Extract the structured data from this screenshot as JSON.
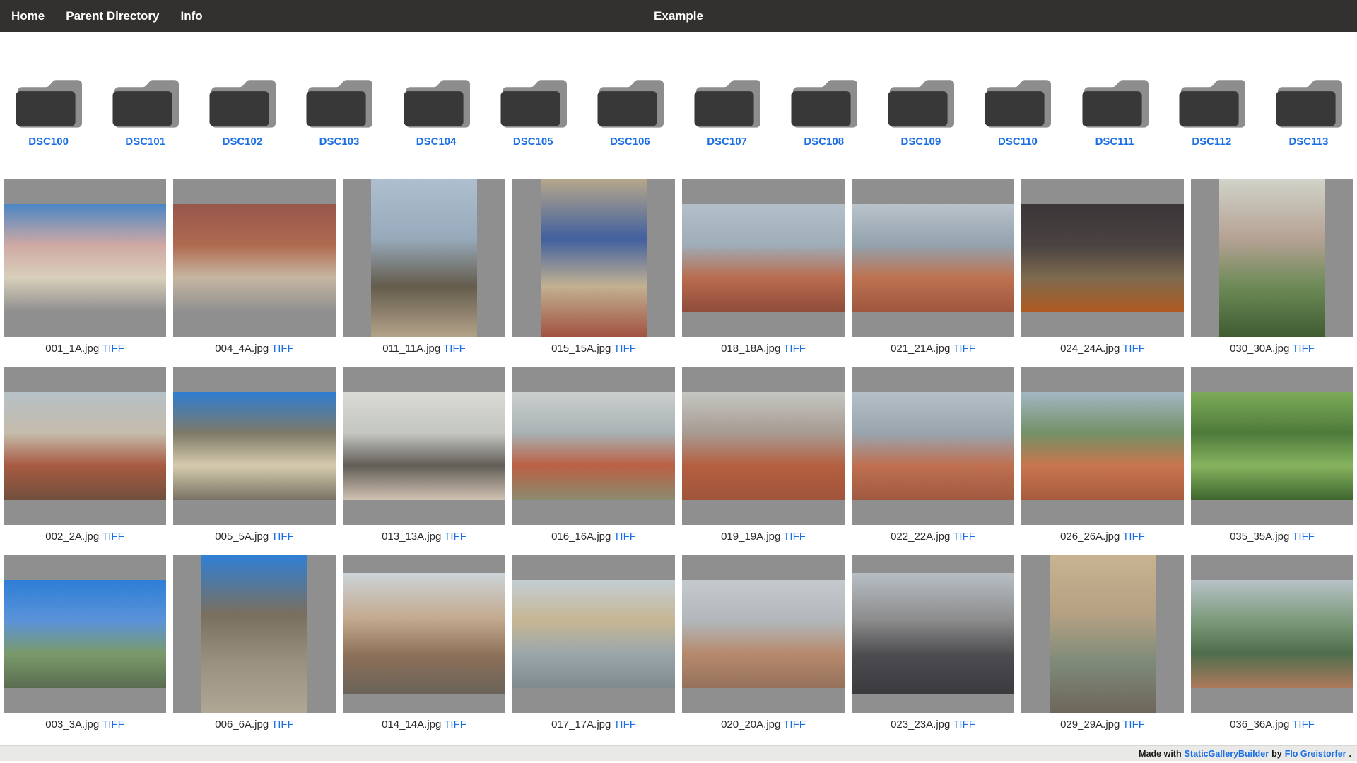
{
  "nav": {
    "links": [
      {
        "label": "Home"
      },
      {
        "label": "Parent Directory"
      },
      {
        "label": "Info"
      }
    ],
    "title": "Example"
  },
  "folders": {
    "items": [
      {
        "label": "DSC100"
      },
      {
        "label": "DSC101"
      },
      {
        "label": "DSC102"
      },
      {
        "label": "DSC103"
      },
      {
        "label": "DSC104"
      },
      {
        "label": "DSC105"
      },
      {
        "label": "DSC106"
      },
      {
        "label": "DSC107"
      },
      {
        "label": "DSC108"
      },
      {
        "label": "DSC109"
      },
      {
        "label": "DSC110"
      },
      {
        "label": "DSC111"
      },
      {
        "label": "DSC112"
      },
      {
        "label": "DSC113"
      }
    ]
  },
  "gallery": {
    "tiff_label": "TIFF",
    "items": [
      {
        "filename": "001_1A.jpg",
        "orientation": "landscape",
        "palette": [
          "#4c86c4",
          "#cfa9a4",
          "#d8cfba",
          "#8e8e8e"
        ]
      },
      {
        "filename": "004_4A.jpg",
        "orientation": "landscape",
        "palette": [
          "#96564a",
          "#b06a50",
          "#c6b6a2",
          "#8f8f8f"
        ]
      },
      {
        "filename": "011_11A.jpg",
        "orientation": "portrait",
        "palette": [
          "#aebfd0",
          "#97a9ba",
          "#645c4c",
          "#b3a289"
        ]
      },
      {
        "filename": "015_15A.jpg",
        "orientation": "portrait",
        "palette": [
          "#b7a78a",
          "#41609f",
          "#c2b191",
          "#a15240"
        ]
      },
      {
        "filename": "018_18A.jpg",
        "orientation": "landscape",
        "palette": [
          "#b3bfc8",
          "#9fadb8",
          "#b96c4e",
          "#8f4c3a"
        ]
      },
      {
        "filename": "021_21A.jpg",
        "orientation": "landscape",
        "palette": [
          "#b9c3cb",
          "#93a2ad",
          "#bd7251",
          "#9e563e"
        ]
      },
      {
        "filename": "024_24A.jpg",
        "orientation": "landscape",
        "palette": [
          "#3c3639",
          "#4a4342",
          "#7d6a4f",
          "#b05a20"
        ]
      },
      {
        "filename": "030_30A.jpg",
        "orientation": "portrait",
        "palette": [
          "#d0d3c9",
          "#b5a294",
          "#6d8a56",
          "#3f5c33"
        ]
      },
      {
        "filename": "002_2A.jpg",
        "orientation": "landscape",
        "palette": [
          "#b6c0c7",
          "#c5bcab",
          "#a85a42",
          "#70503e"
        ]
      },
      {
        "filename": "005_5A.jpg",
        "orientation": "landscape",
        "palette": [
          "#2f7dd0",
          "#7d7a68",
          "#d6cbae",
          "#787264"
        ]
      },
      {
        "filename": "013_13A.jpg",
        "orientation": "landscape",
        "palette": [
          "#d9dad6",
          "#c4c6c2",
          "#615d56",
          "#d2c4b3"
        ]
      },
      {
        "filename": "016_16A.jpg",
        "orientation": "landscape",
        "palette": [
          "#cbd0ce",
          "#a9b1b3",
          "#ba6044",
          "#8b8b6f"
        ]
      },
      {
        "filename": "019_19A.jpg",
        "orientation": "landscape",
        "palette": [
          "#c4c6c2",
          "#a89a92",
          "#b45f40",
          "#a0543a"
        ]
      },
      {
        "filename": "022_22A.jpg",
        "orientation": "landscape",
        "palette": [
          "#b5bfc7",
          "#99a5ae",
          "#bf7050",
          "#a05940"
        ]
      },
      {
        "filename": "026_26A.jpg",
        "orientation": "landscape",
        "palette": [
          "#a3b7c5",
          "#739066",
          "#c7764e",
          "#a85a3e"
        ]
      },
      {
        "filename": "035_35A.jpg",
        "orientation": "landscape",
        "palette": [
          "#7cab58",
          "#4e7a3a",
          "#86b35e",
          "#3e6630"
        ]
      },
      {
        "filename": "003_3A.jpg",
        "orientation": "landscape",
        "palette": [
          "#2e7ed6",
          "#5b93d8",
          "#7b9a6a",
          "#5a6c50"
        ]
      },
      {
        "filename": "006_6A.jpg",
        "orientation": "portrait",
        "palette": [
          "#2f80d6",
          "#7a6f5e",
          "#99907f",
          "#b0a795"
        ]
      },
      {
        "filename": "014_14A.jpg",
        "orientation": "landscape43",
        "palette": [
          "#ccd4d9",
          "#c3a98e",
          "#8c7058",
          "#6a625a"
        ]
      },
      {
        "filename": "017_17A.jpg",
        "orientation": "landscape",
        "palette": [
          "#c3cdd3",
          "#c6b694",
          "#9aa6aa",
          "#7e8a8e"
        ]
      },
      {
        "filename": "020_20A.jpg",
        "orientation": "landscape",
        "palette": [
          "#c3c9cc",
          "#b1b7ba",
          "#b78a6e",
          "#95705a"
        ]
      },
      {
        "filename": "023_23A.jpg",
        "orientation": "landscape43",
        "palette": [
          "#b7bfc5",
          "#8d8d8d",
          "#4c4c50",
          "#3b3b3f"
        ]
      },
      {
        "filename": "029_29A.jpg",
        "orientation": "portrait",
        "palette": [
          "#c8b391",
          "#b4a183",
          "#7e8a79",
          "#6e665a"
        ]
      },
      {
        "filename": "036_36A.jpg",
        "orientation": "landscape",
        "palette": [
          "#b8c2c8",
          "#7b9a7a",
          "#4e6e4e",
          "#ae7a5c"
        ]
      }
    ]
  },
  "footer": {
    "prefix": "Made with",
    "builder_link": "StaticGalleryBuilder",
    "middle": "by",
    "author_link": "Flo Greistorfer",
    "suffix": "."
  },
  "colors": {
    "nav_bg": "#333130",
    "link_blue": "#1b6fe6",
    "thumb_mat_gray": "#8f8f8f",
    "folder_front": "#383838",
    "folder_back": "#8d8d8d",
    "footer_bg": "#e9e9e7"
  }
}
